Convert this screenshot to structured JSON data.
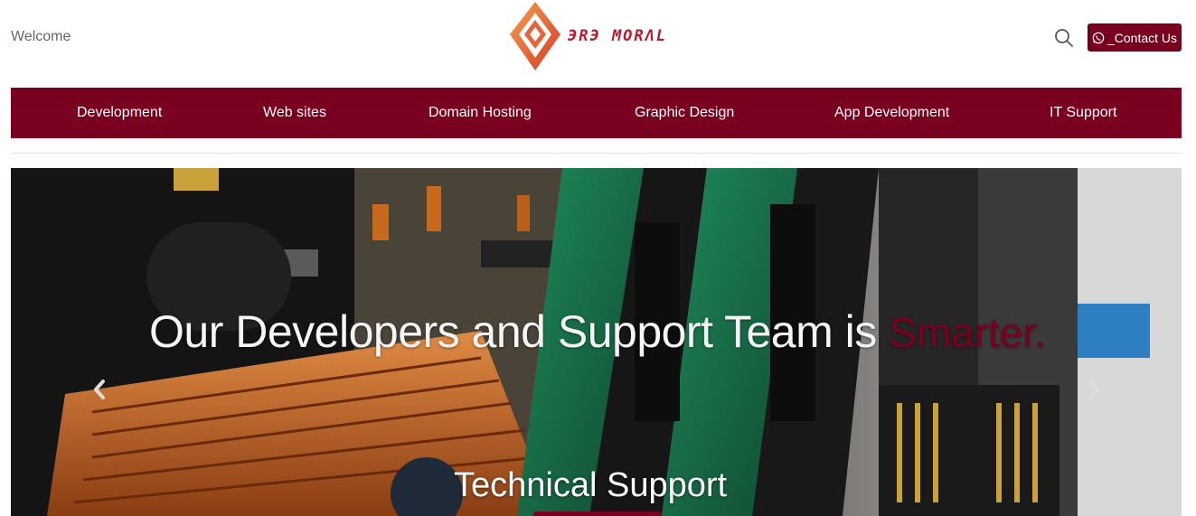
{
  "header": {
    "welcome": "Welcome",
    "logo_text": "ЭRЭ MORΛL",
    "search_icon": "search-icon",
    "contact_label": "_Contact Us",
    "contact_icon": "whatsapp-icon"
  },
  "nav": {
    "items": [
      {
        "label": "Development"
      },
      {
        "label": "Web sites"
      },
      {
        "label": "Domain Hosting"
      },
      {
        "label": "Graphic Design"
      },
      {
        "label": "App Development"
      },
      {
        "label": "IT Support"
      }
    ]
  },
  "hero": {
    "heading": "Our Developers and Support Team is ",
    "heading_accent": "Smarter.",
    "subtitle": "Technical Support",
    "prev_icon": "chevron-left-icon",
    "next_icon": "chevron-right-icon"
  },
  "colors": {
    "brand": "#7a0020",
    "logo_orange": "#f08a3c",
    "logo_red": "#d8392b"
  }
}
